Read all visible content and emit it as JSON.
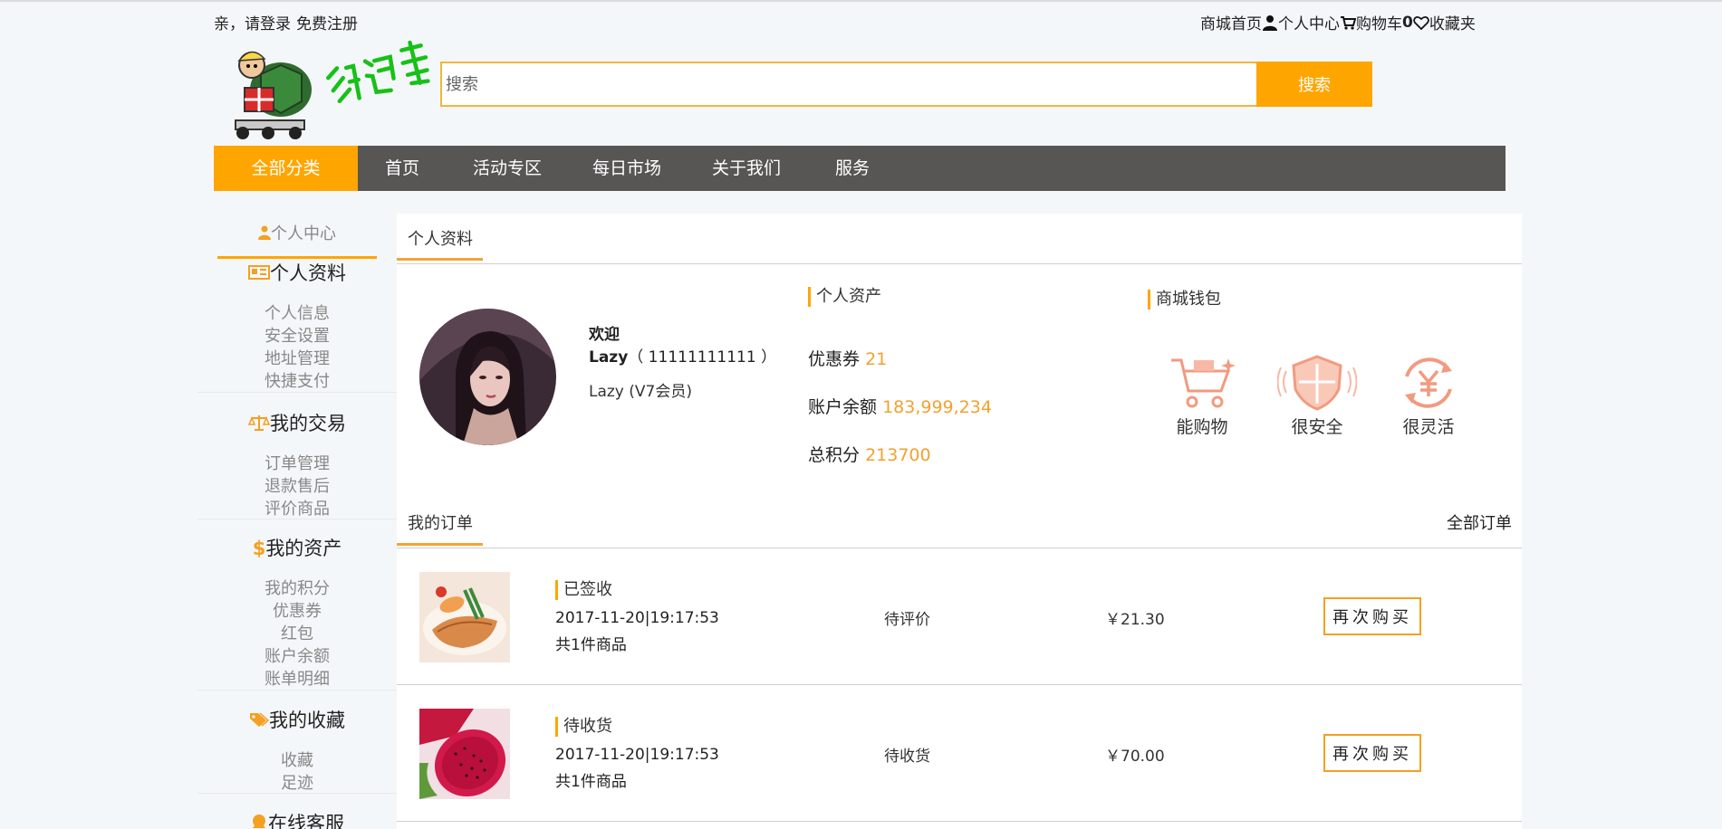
{
  "topbar": {
    "greeting": "亲，请登录",
    "register": "免费注册",
    "home": "商城首页",
    "user_center": "个人中心",
    "cart": "购物车",
    "cart_count": "0",
    "favorites": "收藏夹"
  },
  "search": {
    "placeholder": "搜索",
    "button": "搜索"
  },
  "nav": {
    "all": "全部分类",
    "items": [
      "首页",
      "活动专区",
      "每日市场",
      "关于我们",
      "服务"
    ]
  },
  "sidebar": {
    "title": "个人中心",
    "groups": [
      {
        "title": "个人资料",
        "icon": "id-card-icon",
        "links": [
          "个人信息",
          "安全设置",
          "地址管理",
          "快捷支付"
        ]
      },
      {
        "title": "我的交易",
        "icon": "scale-icon",
        "links": [
          "订单管理",
          "退款售后",
          "评价商品"
        ]
      },
      {
        "title": "我的资产",
        "icon": "dollar-icon",
        "links": [
          "我的积分",
          "优惠券",
          "红包",
          "账户余额",
          "账单明细"
        ]
      },
      {
        "title": "我的收藏",
        "icon": "tag-icon",
        "links": [
          "收藏",
          "足迹"
        ]
      },
      {
        "title": "在线客服",
        "icon": "chat-icon",
        "links": []
      }
    ]
  },
  "profile": {
    "tab": "个人资料",
    "welcome": "欢迎",
    "username": "Lazy",
    "phone": "（ 11111111111 ）",
    "member": "Lazy (V7会员)"
  },
  "assets": {
    "title": "个人资产",
    "coupon_label": "优惠券",
    "coupon_value": "21",
    "balance_label": "账户余额",
    "balance_value": "183,999,234",
    "points_label": "总积分",
    "points_value": "213700"
  },
  "wallet": {
    "title": "商城钱包",
    "features": [
      "能购物",
      "很安全",
      "很灵活"
    ]
  },
  "orders": {
    "tab": "我的订单",
    "all_link": "全部订单",
    "list": [
      {
        "status": "已签收",
        "datetime": "2017-11-20|19:17:53",
        "count": "共1件商品",
        "state": "待评价",
        "price": "￥21.30",
        "button": "再次购买"
      },
      {
        "status": "待收货",
        "datetime": "2017-11-20|19:17:53",
        "count": "共1件商品",
        "state": "待收货",
        "price": "￥70.00",
        "button": "再次购买"
      }
    ]
  },
  "colors": {
    "accent": "#ffa500",
    "nav_bg": "#585555",
    "orange_text": "#f2a12e"
  }
}
